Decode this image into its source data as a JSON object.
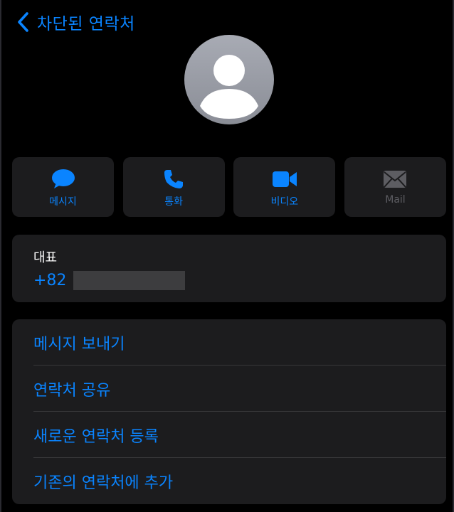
{
  "nav": {
    "back_label": "차단된 연락처",
    "back_icon": "chevron-left-icon"
  },
  "avatar": {
    "icon": "person-placeholder-icon"
  },
  "actions": [
    {
      "label": "메시지",
      "icon": "message-bubble-icon",
      "enabled": true
    },
    {
      "label": "통화",
      "icon": "phone-icon",
      "enabled": true
    },
    {
      "label": "비디오",
      "icon": "video-camera-icon",
      "enabled": true
    },
    {
      "label": "Mail",
      "icon": "envelope-icon",
      "enabled": false
    }
  ],
  "phone": {
    "kind_label": "대표",
    "number_prefix": "+82"
  },
  "menu": [
    {
      "label": "메시지 보내기"
    },
    {
      "label": "연락처 공유"
    },
    {
      "label": "새로운 연락처 등록"
    },
    {
      "label": "기존의 연락처에 추가"
    }
  ],
  "colors": {
    "accent": "#0a84ff",
    "background": "#000000",
    "card": "#1c1c1e",
    "disabled": "#5d5d62",
    "separator": "#38383a"
  }
}
